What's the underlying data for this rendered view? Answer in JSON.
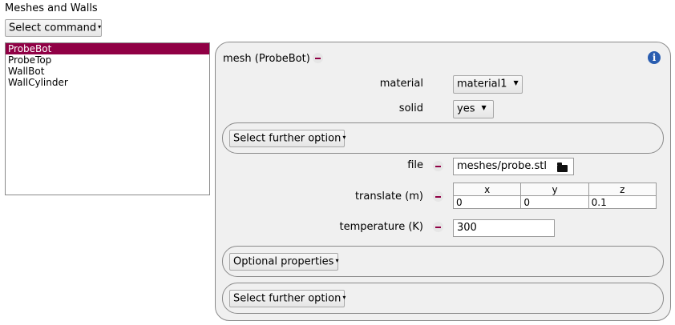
{
  "section_title": "Meshes and Walls",
  "select_command_label": "Select command",
  "items": [
    "ProbeBot",
    "ProbeTop",
    "WallBot",
    "WallCylinder"
  ],
  "selected_item": "ProbeBot",
  "panel": {
    "header": "mesh (ProbeBot)",
    "material": {
      "label": "material",
      "value": "material1"
    },
    "solid": {
      "label": "solid",
      "value": "yes"
    },
    "further_option_1": "Select further option",
    "file": {
      "label": "file",
      "value": "meshes/probe.stl"
    },
    "translate": {
      "label": "translate (m)",
      "columns": [
        "x",
        "y",
        "z"
      ],
      "values": [
        "0",
        "0",
        "0.1"
      ]
    },
    "temperature": {
      "label": "temperature (K)",
      "value": "300"
    },
    "optional_properties": "Optional properties",
    "further_option_2": "Select further option"
  },
  "colors": {
    "selection": "#900045",
    "minus": "#900045",
    "info": "#2a5db0"
  }
}
